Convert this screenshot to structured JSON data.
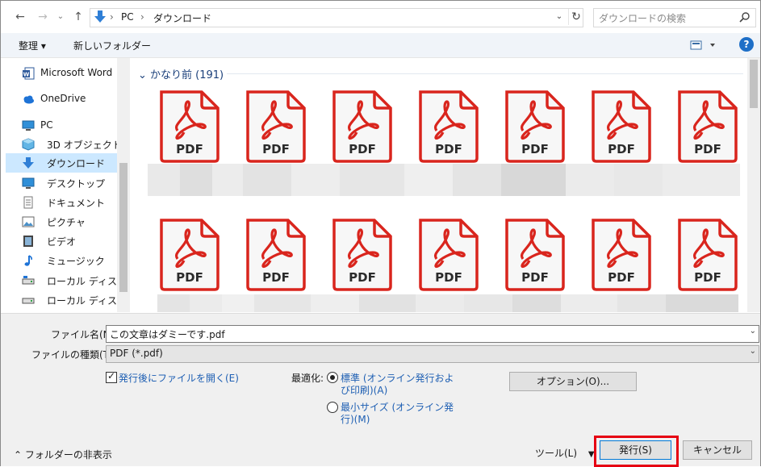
{
  "address": {
    "path": [
      "PC",
      "ダウンロード"
    ],
    "search_placeholder": "ダウンロードの検索"
  },
  "toolbar": {
    "organize": "整理 ▾",
    "new_folder": "新しいフォルダー"
  },
  "sidebar": {
    "items": [
      {
        "label": "Microsoft Word",
        "icon": "word-icon"
      },
      {
        "label": "OneDrive",
        "icon": "cloud-icon"
      },
      {
        "label": "PC",
        "icon": "pc-icon"
      },
      {
        "label": "3D オブジェクト",
        "icon": "cube-icon"
      },
      {
        "label": "ダウンロード",
        "icon": "download-icon"
      },
      {
        "label": "デスクトップ",
        "icon": "desktop-icon"
      },
      {
        "label": "ドキュメント",
        "icon": "document-icon"
      },
      {
        "label": "ピクチャ",
        "icon": "picture-icon"
      },
      {
        "label": "ビデオ",
        "icon": "video-icon"
      },
      {
        "label": "ミュージック",
        "icon": "music-icon"
      },
      {
        "label": "ローカル ディスク (C",
        "icon": "drive-icon"
      },
      {
        "label": "ローカル ディスク (D",
        "icon": "drive-icon"
      }
    ],
    "selected": "ダウンロード"
  },
  "content": {
    "group_header": "かなり前 (191)",
    "tile_label": "PDF",
    "colors": {
      "pdf_red": "#d9251d",
      "tile_bg": "#f7f7f7"
    }
  },
  "bottom": {
    "filename_label": "ファイル名(N):",
    "filename_value": "この文章はダミーです.pdf",
    "filetype_label": "ファイルの種類(T):",
    "filetype_value": "PDF (*.pdf)",
    "open_after_label": "発行後にファイルを開く(E)",
    "optimize_label": "最適化:",
    "radio_standard_line1": "標準 (オンライン発行およ",
    "radio_standard_line2": "び印刷)(A)",
    "radio_min_line1": "最小サイズ (オンライン発",
    "radio_min_line2": "行)(M)",
    "options_button": "オプション(O)...",
    "hide_folders": "フォルダーの非表示",
    "tools": "ツール(L)",
    "publish_button": "発行(S)",
    "cancel_button": "キャンセル"
  }
}
